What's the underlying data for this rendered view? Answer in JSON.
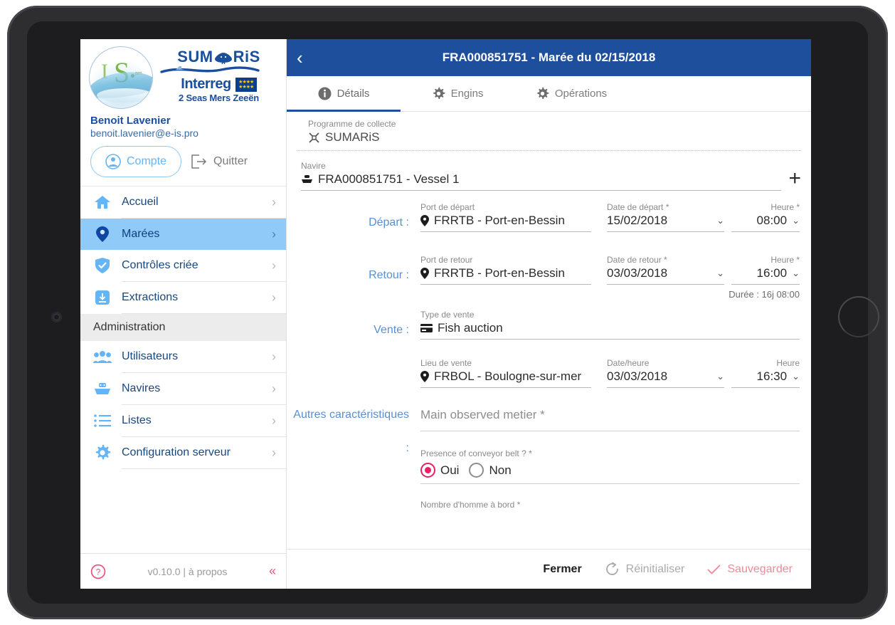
{
  "sidebar": {
    "logo_alt": "sumaris-circle-logo",
    "brand": {
      "sumaris": "SUM",
      "sumaris_tail": "RiS",
      "interreg": "Interreg",
      "seas": "2 Seas Mers Zeeën"
    },
    "user": {
      "name": "Benoit Lavenier",
      "email": "benoit.lavenier@e-is.pro"
    },
    "account_label": "Compte",
    "logout_label": "Quitter",
    "section_admin": "Administration",
    "items": [
      {
        "label": "Accueil",
        "icon": "home-icon"
      },
      {
        "label": "Marées",
        "icon": "location-pin-icon"
      },
      {
        "label": "Contrôles criée",
        "icon": "shield-check-icon"
      },
      {
        "label": "Extractions",
        "icon": "download-icon"
      }
    ],
    "admin_items": [
      {
        "label": "Utilisateurs",
        "icon": "users-icon"
      },
      {
        "label": "Navires",
        "icon": "boat-icon"
      },
      {
        "label": "Listes",
        "icon": "list-icon"
      },
      {
        "label": "Configuration serveur",
        "icon": "gear-icon"
      }
    ],
    "footer": {
      "help_icon": "help-circle-icon",
      "version": "v0.10.0 | à propos",
      "collapse_icon": "double-chevron-left-icon"
    }
  },
  "header": {
    "back_icon": "chevron-left-icon",
    "title": "FRA000851751 - Marée du 02/15/2018"
  },
  "tabs": [
    {
      "label": "Détails",
      "icon": "info-circle-icon",
      "active": true
    },
    {
      "label": "Engins",
      "icon": "gear-icon",
      "active": false
    },
    {
      "label": "Opérations",
      "icon": "gear-icon",
      "active": false
    }
  ],
  "form": {
    "programme": {
      "label": "Programme de collecte",
      "value": "SUMARiS",
      "icon": "program-icon"
    },
    "navire": {
      "label": "Navire",
      "value": "FRA000851751 - Vessel 1",
      "icon": "boat-small-icon",
      "add_icon": "plus-icon"
    },
    "depart": {
      "row_label": "Départ :",
      "port_label": "Port de départ",
      "port_value": "FRRTB - Port-en-Bessin",
      "date_label": "Date de départ *",
      "date_value": "15/02/2018",
      "time_label": "Heure *",
      "time_value": "08:00"
    },
    "retour": {
      "row_label": "Retour :",
      "port_label": "Port de retour",
      "port_value": "FRRTB - Port-en-Bessin",
      "date_label": "Date de retour *",
      "date_value": "03/03/2018",
      "time_label": "Heure *",
      "time_value": "16:00"
    },
    "duree": "Durée : 16j 08:00",
    "vente": {
      "row_label": "Vente :",
      "type_label": "Type de vente",
      "type_value": "Fish auction",
      "type_icon": "auction-card-icon",
      "lieu_label": "Lieu de vente",
      "lieu_value": "FRBOL - Boulogne-sur-mer",
      "date_label": "Date/heure",
      "date_value": "03/03/2018",
      "time_label": "Heure",
      "time_value": "16:30"
    },
    "autres": {
      "row_label": "Autres caractéristiques",
      "row_label2": ":",
      "metier_placeholder": "Main observed metier *",
      "conveyor_label": "Presence of conveyor belt ? *",
      "conveyor_options": [
        {
          "label": "Oui",
          "checked": true
        },
        {
          "label": "Non",
          "checked": false
        }
      ],
      "crew_label": "Nombre d'homme à bord *"
    }
  },
  "actions": {
    "close_label": "Fermer",
    "reset_label": "Réinitialiser",
    "reset_icon": "refresh-icon",
    "save_label": "Sauvegarder",
    "save_icon": "check-icon"
  },
  "colors": {
    "header_blue": "#1e4f9c",
    "accent_blue": "#64b5f6",
    "selected_blue": "#90caf9",
    "nav_text": "#18477e",
    "pink": "#e91e63",
    "save_pink": "#f08a96"
  }
}
